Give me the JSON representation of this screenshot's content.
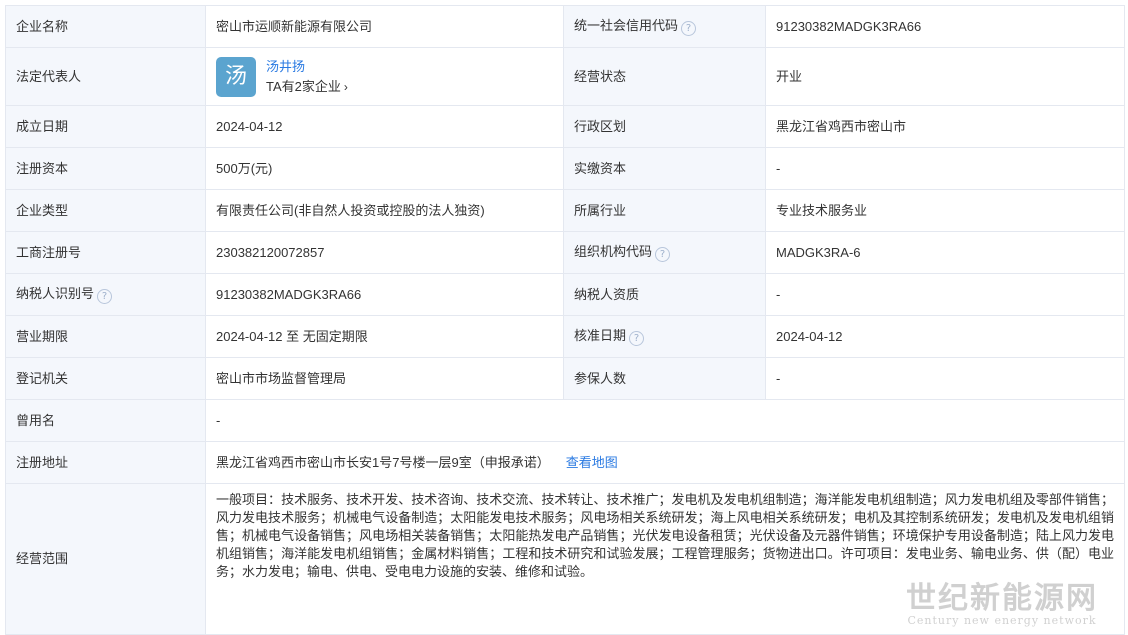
{
  "rows": {
    "r1": {
      "label_a": "企业名称",
      "value_a": "密山市运顺新能源有限公司",
      "label_b": "统一社会信用代码",
      "value_b": "91230382MADGK3RA66"
    },
    "r2": {
      "label_a": "法定代表人",
      "avatar_char": "汤",
      "rep_name": "汤井扬",
      "rep_companies": "TA有2家企业",
      "label_b": "经营状态",
      "value_b": "开业"
    },
    "r3": {
      "label_a": "成立日期",
      "value_a": "2024-04-12",
      "label_b": "行政区划",
      "value_b": "黑龙江省鸡西市密山市"
    },
    "r4": {
      "label_a": "注册资本",
      "value_a": "500万(元)",
      "label_b": "实缴资本",
      "value_b": "-"
    },
    "r5": {
      "label_a": "企业类型",
      "value_a": "有限责任公司(非自然人投资或控股的法人独资)",
      "label_b": "所属行业",
      "value_b": "专业技术服务业"
    },
    "r6": {
      "label_a": "工商注册号",
      "value_a": "230382120072857",
      "label_b": "组织机构代码",
      "value_b": "MADGK3RA-6"
    },
    "r7": {
      "label_a": "纳税人识别号",
      "value_a": "91230382MADGK3RA66",
      "label_b": "纳税人资质",
      "value_b": "-"
    },
    "r8": {
      "label_a": "营业期限",
      "value_a": "2024-04-12 至 无固定期限",
      "label_b": "核准日期",
      "value_b": "2024-04-12"
    },
    "r9": {
      "label_a": "登记机关",
      "value_a": "密山市市场监督管理局",
      "label_b": "参保人数",
      "value_b": "-"
    },
    "r10": {
      "label": "曾用名",
      "value": "-"
    },
    "r11": {
      "label": "注册地址",
      "value": "黑龙江省鸡西市密山市长安1号7号楼一层9室（申报承诺）",
      "link": "查看地图"
    },
    "r12": {
      "label": "经营范围",
      "value": "一般项目：技术服务、技术开发、技术咨询、技术交流、技术转让、技术推广；发电机及发电机组制造；海洋能发电机组制造；风力发电机组及零部件销售；风力发电技术服务；机械电气设备制造；太阳能发电技术服务；风电场相关系统研发；海上风电相关系统研发；电机及其控制系统研发；发电机及发电机组销售；机械电气设备销售；风电场相关装备销售；太阳能热发电产品销售；光伏发电设备租赁；光伏设备及元器件销售；环境保护专用设备制造；陆上风力发电机组销售；海洋能发电机组销售；金属材料销售；工程和技术研究和试验发展；工程管理服务；货物进出口。许可项目：发电业务、输电业务、供（配）电业务；水力发电；输电、供电、受电电力设施的安装、维修和试验。"
    }
  },
  "help_glyph": "?",
  "chevron_glyph": "›",
  "watermark": {
    "text": "世纪新能源网",
    "sub": "Century new energy network"
  }
}
